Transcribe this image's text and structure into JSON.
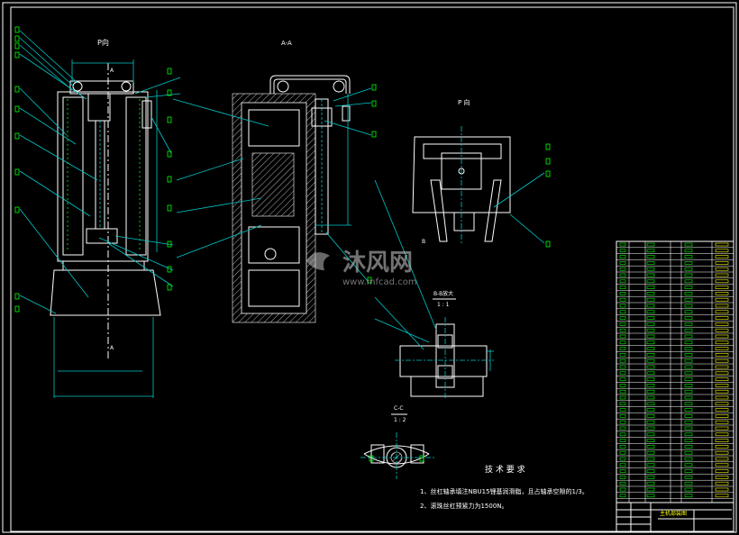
{
  "views": {
    "main_label": "P向",
    "section_aa": "A-A",
    "view_p": "P 向",
    "detail_bb": "B-B放大",
    "scale_bb": "1 : 1",
    "detail_cc": "C-C",
    "scale_cc": "1 : 2",
    "mark_a": "A",
    "mark_b": "B"
  },
  "watermark": {
    "brand": "沐风网",
    "url": "www.mfcad.com"
  },
  "notes": {
    "title": "技 术 要 求",
    "line1": "1、丝杠轴承填注NBU15锂基润滑脂，且占轴承空隙的1/3。",
    "line2": "2、滚珠丝杠预紧力为1500N。"
  },
  "title_block": {
    "name": "主机部装图"
  },
  "colors": {
    "background": "#000000",
    "outline": "#ffffff",
    "leader": "#00c8c8",
    "annotation": "#00ff00",
    "title_text": "#ffff00"
  }
}
